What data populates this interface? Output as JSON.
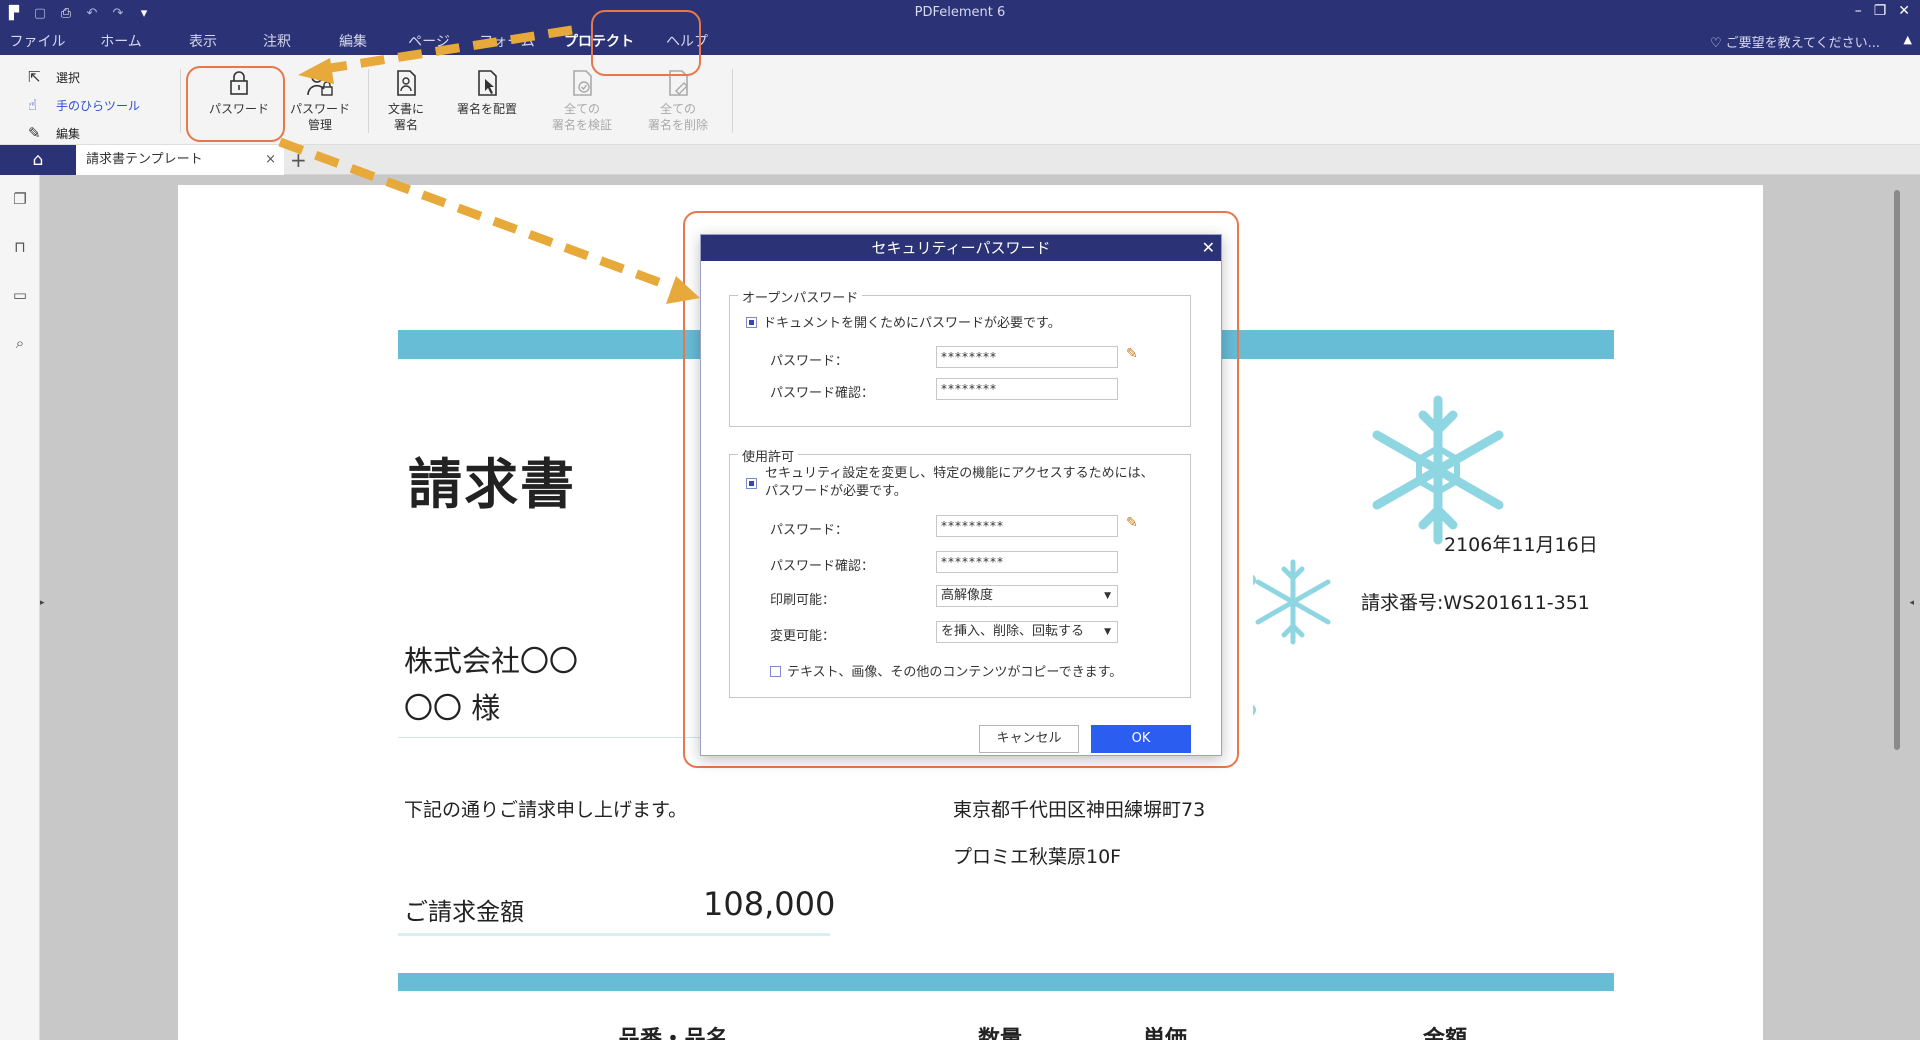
{
  "app": {
    "title": "PDFelement 6",
    "window_controls": [
      "–",
      "❐",
      "✕"
    ]
  },
  "menu": [
    {
      "label": "ファイル",
      "w": 0
    },
    {
      "label": "ホーム"
    },
    {
      "label": "表示"
    },
    {
      "label": "注釈"
    },
    {
      "label": "編集"
    },
    {
      "label": "ページ"
    },
    {
      "label": "フォーム"
    },
    {
      "label": "プロテクト"
    },
    {
      "label": "ヘルプ"
    }
  ],
  "help_request": "ご要望を教えてください...",
  "ribbon": {
    "tools": [
      {
        "label": "選択",
        "icon": "cursor-icon"
      },
      {
        "label": "手のひらツール",
        "icon": "hand-icon"
      },
      {
        "label": "編集",
        "icon": "edit-icon"
      }
    ],
    "buttons": [
      {
        "label1": "パスワード",
        "label2": ""
      },
      {
        "label1": "パスワード",
        "label2": "管理"
      },
      {
        "label1": "文書に",
        "label2": "署名"
      },
      {
        "label1": "署名を配置",
        "label2": ""
      },
      {
        "label1": "全ての",
        "label2": "署名を検証"
      },
      {
        "label1": "全ての",
        "label2": "署名を削除"
      }
    ]
  },
  "tabs": {
    "doc_title": "請求書テンプレート",
    "close": "×",
    "add": "+"
  },
  "document": {
    "title": "請求書",
    "date": "2106年11月16日",
    "invoice_no": "請求番号:WS201611-351",
    "company": "株式会社〇〇",
    "customer": "〇〇 様",
    "message": "下記の通りご請求申し上げます。",
    "address1": "東京都千代田区神田練塀町73",
    "address2": "プロミエ秋葉原10F",
    "amount_label": "ご請求金額",
    "amount_value": "108,000",
    "table_headers": [
      "品番・品名",
      "数量",
      "単価",
      "金額"
    ]
  },
  "dialog": {
    "title": "セキュリティーパスワード",
    "close": "✕",
    "open_group": {
      "legend": "オープンパスワード",
      "require_label": "ドキュメントを開くためにパスワードが必要です。",
      "require_checked": true,
      "password_label": "パスワード：",
      "password_value": "********",
      "confirm_label": "パスワード確認：",
      "confirm_value": "********"
    },
    "perm_group": {
      "legend": "使用許可",
      "require_label_1": "セキュリティ設定を変更し、特定の機能にアクセスするためには、パスワードが必要です。",
      "require_checked": true,
      "password_label": "パスワード：",
      "password_value": "*********",
      "confirm_label": "パスワード確認：",
      "confirm_value": "*********",
      "print_label": "印刷可能：",
      "print_value": "高解像度",
      "change_label": "変更可能：",
      "change_value": "を挿入、削除、回転する",
      "copy_label": "テキスト、画像、その他のコンテンツがコピーできます。",
      "copy_checked": false
    },
    "cancel_label": "キャンセル",
    "ok_label": "OK"
  },
  "colors": {
    "title_bar": "#2b3275",
    "band": "#67bcd6",
    "snowflake": "#8fd6e3",
    "highlight": "#e8774b",
    "arrow": "#e6a93a",
    "ok": "#2b5df0"
  }
}
